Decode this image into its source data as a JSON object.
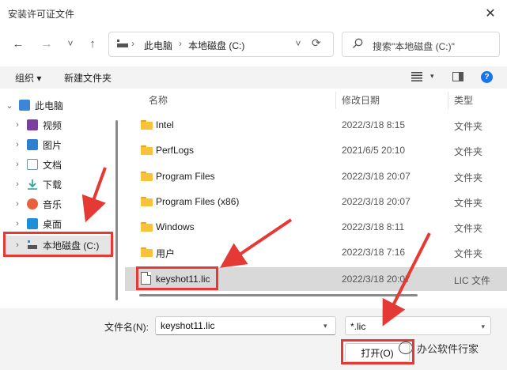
{
  "window": {
    "title": "安装许可证文件",
    "close_glyph": "✕"
  },
  "nav": {
    "back": "←",
    "forward": "→",
    "recent": "˅",
    "up": "↑",
    "breadcrumb": [
      "此电脑",
      "本地磁盘 (C:)"
    ],
    "separator": "›",
    "dropdown": "˅",
    "refresh": "⟳",
    "search_placeholder": "搜索\"本地磁盘 (C:)\""
  },
  "toolbar": {
    "organize": "组织 ▾",
    "new_folder": "新建文件夹",
    "help": "?",
    "view_caret": "▾"
  },
  "sidebar": {
    "items": [
      {
        "label": "此电脑",
        "icon": "computer-icon",
        "chevron": "⌄",
        "color": "#3a86d8"
      },
      {
        "label": "视频",
        "icon": "video-icon",
        "chevron": "›",
        "color": "#7b3fa0"
      },
      {
        "label": "图片",
        "icon": "picture-icon",
        "chevron": "›",
        "color": "#2f7fd0"
      },
      {
        "label": "文档",
        "icon": "document-icon",
        "chevron": "›",
        "color": "#6f8fb0"
      },
      {
        "label": "下载",
        "icon": "download-icon",
        "chevron": "›",
        "color": "#20a08a"
      },
      {
        "label": "音乐",
        "icon": "music-icon",
        "chevron": "›",
        "color": "#e8603c"
      },
      {
        "label": "桌面",
        "icon": "desktop-icon",
        "chevron": "›",
        "color": "#1f8fd8"
      },
      {
        "label": "本地磁盘 (C:)",
        "icon": "drive-icon",
        "chevron": "›",
        "color": "#555555"
      }
    ]
  },
  "files": {
    "columns": {
      "name": "名称",
      "date": "修改日期",
      "type": "类型"
    },
    "rows": [
      {
        "name": "Intel",
        "date": "2022/3/18 8:15",
        "type": "文件夹",
        "kind": "folder"
      },
      {
        "name": "PerfLogs",
        "date": "2021/6/5 20:10",
        "type": "文件夹",
        "kind": "folder"
      },
      {
        "name": "Program Files",
        "date": "2022/3/18 20:07",
        "type": "文件夹",
        "kind": "folder"
      },
      {
        "name": "Program Files (x86)",
        "date": "2022/3/18 20:07",
        "type": "文件夹",
        "kind": "folder"
      },
      {
        "name": "Windows",
        "date": "2022/3/18 8:11",
        "type": "文件夹",
        "kind": "folder"
      },
      {
        "name": "用户",
        "date": "2022/3/18 7:16",
        "type": "文件夹",
        "kind": "folder"
      },
      {
        "name": "keyshot11.lic",
        "date": "2022/3/18 20:07",
        "type": "LIC 文件",
        "kind": "file"
      }
    ]
  },
  "bottom": {
    "filename_label": "文件名(N):",
    "filename_value": "keyshot11.lic",
    "filter_value": "*.lic",
    "open_label": "打开(O)",
    "dropdown_caret": "▾"
  },
  "watermark": {
    "text": "办公软件行家"
  },
  "colors": {
    "annotation": "#e53935",
    "accent": "#1a73e8"
  }
}
